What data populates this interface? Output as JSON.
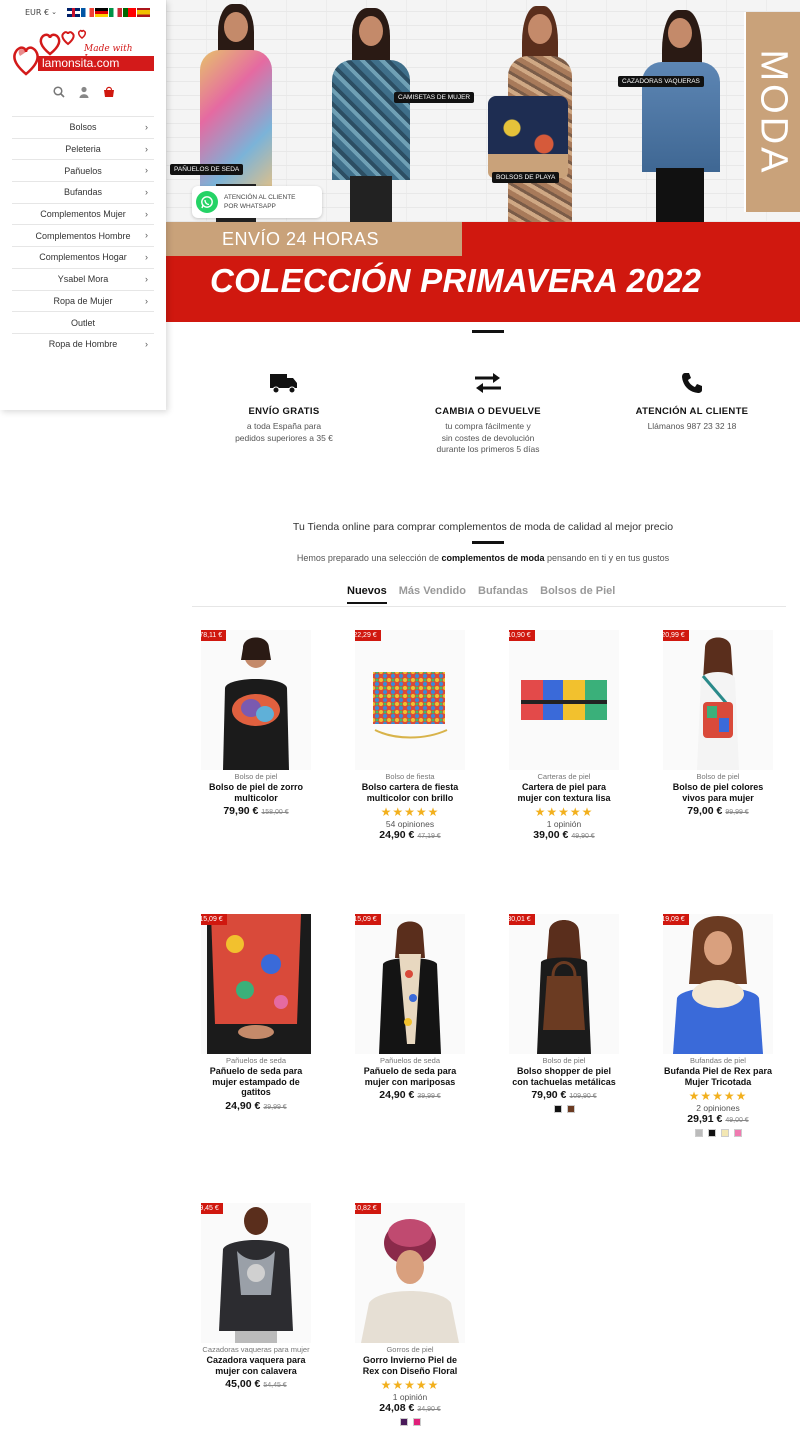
{
  "header": {
    "currency": "EUR €",
    "flags": [
      "uk",
      "fr",
      "de",
      "it",
      "pt",
      "es"
    ]
  },
  "logo": {
    "tagline": "Made with Love",
    "name": "lamonsita.com"
  },
  "sidebar": {
    "items": [
      {
        "label": "Bolsos",
        "chevron": true
      },
      {
        "label": "Peleteria",
        "chevron": true
      },
      {
        "label": "Pañuelos",
        "chevron": true
      },
      {
        "label": "Bufandas",
        "chevron": true
      },
      {
        "label": "Complementos Mujer",
        "chevron": true
      },
      {
        "label": "Complementos Hombre",
        "chevron": true
      },
      {
        "label": "Complementos Hogar",
        "chevron": true
      },
      {
        "label": "Ysabel Mora",
        "chevron": true
      },
      {
        "label": "Ropa de Mujer",
        "chevron": true
      },
      {
        "label": "Outlet",
        "chevron": false
      },
      {
        "label": "Ropa de Hombre",
        "chevron": true
      }
    ]
  },
  "hero": {
    "tags": [
      "PAÑUELOS DE SEDA",
      "CAMISETAS DE MUJER",
      "BOLSOS DE PLAYA",
      "CAZADORAS VAQUERAS"
    ],
    "side_label": "MODA",
    "whatsapp_line1": "ATENCIÓN AL CLIENTE",
    "whatsapp_line2": "POR WHATSAPP",
    "strip": "ENVÍO 24 HORAS",
    "headline": "COLECCIÓN PRIMAVERA 2022"
  },
  "features": [
    {
      "title": "ENVÍO GRATIS",
      "line1": "a toda España para",
      "line2": "pedidos superiores a 35 €",
      "line3": ""
    },
    {
      "title": "CAMBIA O DEVUELVE",
      "line1": "tu compra fácilmente y",
      "line2": "sin costes de devolución",
      "line3": "durante los primeros 5 días"
    },
    {
      "title": "ATENCIÓN AL CLIENTE",
      "line1": "Llámanos 987 23 32 18",
      "line2": "",
      "line3": ""
    }
  ],
  "intro": {
    "tagline": "Tu Tienda online para comprar complementos de moda de calidad al mejor precio",
    "sub_before": "Hemos preparado una selección de ",
    "sub_bold": "complementos de moda",
    "sub_after": " pensando en ti y en tus gustos"
  },
  "tabs": [
    "Nuevos",
    "Más Vendido",
    "Bufandas",
    "Bolsos de Piel"
  ],
  "products": [
    {
      "badge": "-78,11 €",
      "category": "Bolso de piel",
      "name": "Bolso de piel de zorro multicolor",
      "price": "79,90 €",
      "old": "158,00 €",
      "stars": "",
      "reviews": ""
    },
    {
      "badge": "-22,29 €",
      "category": "Bolso de fiesta",
      "name": "Bolso cartera de fiesta multicolor con brillo",
      "price": "24,90 €",
      "old": "47,19 €",
      "stars": "★★★★★",
      "reviews": "54 opiniones"
    },
    {
      "badge": "-10,90 €",
      "category": "Carteras de piel",
      "name": "Cartera de piel para mujer con textura lisa",
      "price": "39,00 €",
      "old": "49,90 €",
      "stars": "★★★★★",
      "reviews": "1 opinión"
    },
    {
      "badge": "-20,99 €",
      "category": "Bolso de piel",
      "name": "Bolso de piel colores vivos para mujer",
      "price": "79,00 €",
      "old": "99,99 €",
      "stars": "",
      "reviews": ""
    },
    {
      "badge": "-15,09 €",
      "category": "Pañuelos de seda",
      "name": "Pañuelo de seda para mujer estampado de gatitos",
      "price": "24,90 €",
      "old": "39,99 €",
      "stars": "",
      "reviews": ""
    },
    {
      "badge": "-15,09 €",
      "category": "Pañuelos de seda",
      "name": "Pañuelo de seda para mujer con mariposas",
      "price": "24,90 €",
      "old": "39,99 €",
      "stars": "",
      "reviews": ""
    },
    {
      "badge": "-30,01 €",
      "category": "Bolso de piel",
      "name": "Bolso shopper de piel con tachuelas metálicas",
      "price": "79,90 €",
      "old": "109,90 €",
      "stars": "",
      "reviews": ""
    },
    {
      "badge": "-19,09 €",
      "category": "Bufandas de piel",
      "name": "Bufanda Piel de Rex para Mujer Tricotada",
      "price": "29,91 €",
      "old": "49,00 €",
      "stars": "★★★★★",
      "reviews": "2 opiniones"
    },
    {
      "badge": "-9,45 €",
      "category": "Cazadoras vaqueras para mujer",
      "name": "Cazadora vaquera para mujer con calavera",
      "price": "45,00 €",
      "old": "54,45 €",
      "stars": "",
      "reviews": ""
    },
    {
      "badge": "-10,82 €",
      "category": "Gorros de piel",
      "name": "Gorro Invierno Piel de Rex con Diseño Floral",
      "price": "24,08 €",
      "old": "34,90 €",
      "stars": "★★★★★",
      "reviews": "1 opinión"
    }
  ],
  "colors": {
    "brand_red": "#d0180f",
    "gold": "#c9a27a",
    "star": "#f2b01e"
  }
}
